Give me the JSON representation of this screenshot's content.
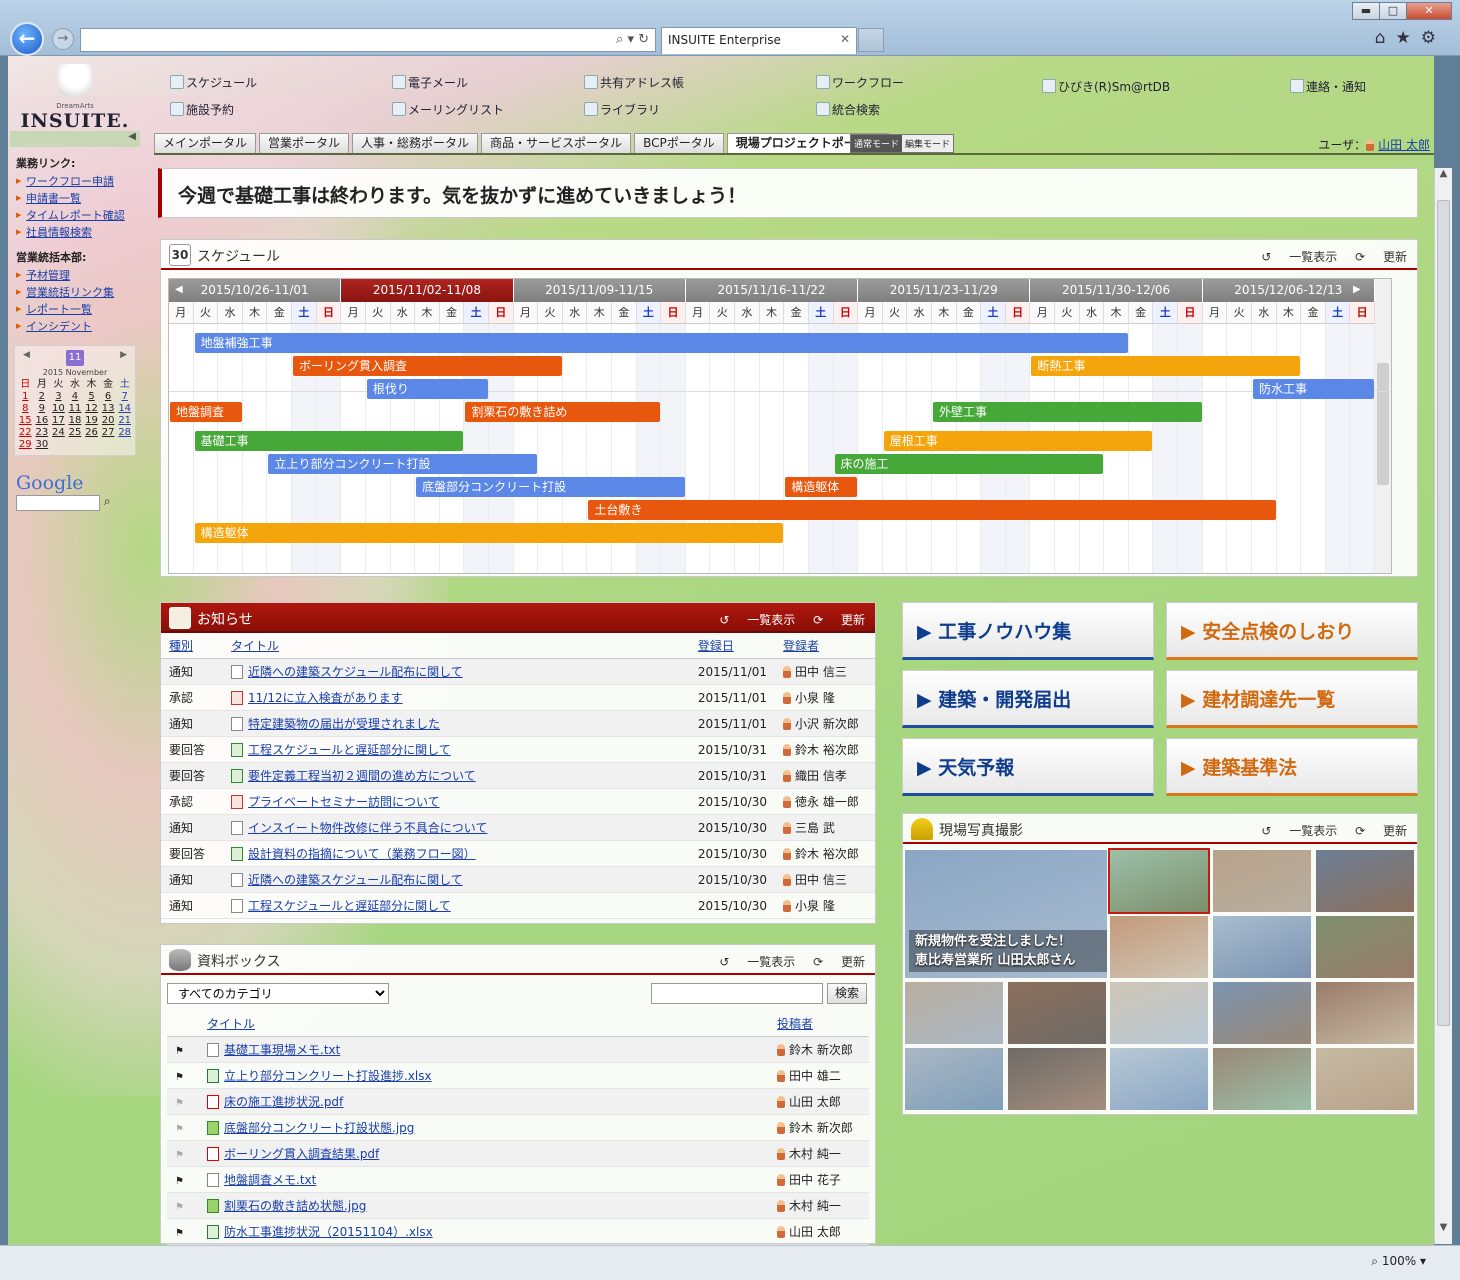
{
  "browser": {
    "tab_title": "INSUITE Enterprise",
    "zoom": "100%",
    "min_label": "▬",
    "max_label": "□",
    "close_label": "✕"
  },
  "header": {
    "logo_name": "INSUITE.",
    "logo_sub": "DreamArts",
    "menu": [
      {
        "label": "スケジュール",
        "icon": "calendar-icon"
      },
      {
        "label": "施設予約",
        "icon": "pen-icon"
      },
      {
        "label": "電子メール",
        "icon": "mail-icon"
      },
      {
        "label": "メーリングリスト",
        "icon": "mailing-list-icon"
      },
      {
        "label": "共有アドレス帳",
        "icon": "address-book-icon"
      },
      {
        "label": "ライブラリ",
        "icon": "library-icon"
      },
      {
        "label": "ワークフロー",
        "icon": "workflow-icon"
      },
      {
        "label": "統合検索",
        "icon": "search-icon"
      },
      {
        "label": "ひびき(R)Sm@rtDB",
        "icon": "database-icon"
      },
      {
        "label": "連絡・通知",
        "icon": "notice-icon"
      }
    ],
    "portal_tabs": [
      "メインポータル",
      "営業ポータル",
      "人事・総務ポータル",
      "商品・サービスポータル",
      "BCPポータル",
      "現場プロジェクトポータル"
    ],
    "active_tab": "現場プロジェクトポータル",
    "mode_normal": "通常モード",
    "mode_edit": "編集モード",
    "user_prefix": "ユーザ：",
    "user_name": "山田 太郎"
  },
  "sidebar": {
    "groups": [
      {
        "title": "業務リンク:",
        "items": [
          "ワークフロー申請",
          "申請書一覧",
          "タイムレポート確認",
          "社員情報検索"
        ]
      },
      {
        "title": "営業統括本部:",
        "items": [
          "予材管理",
          "営業統括リンク集",
          "レポート一覧",
          "インシデント"
        ]
      }
    ],
    "calendar": {
      "month_badge": "11",
      "year_month": "2015 November",
      "weekdays": [
        "日",
        "月",
        "火",
        "水",
        "木",
        "金",
        "土"
      ],
      "weeks": [
        [
          "1",
          "2",
          "3",
          "4",
          "5",
          "6",
          "7"
        ],
        [
          "8",
          "9",
          "10",
          "11",
          "12",
          "13",
          "14"
        ],
        [
          "15",
          "16",
          "17",
          "18",
          "19",
          "20",
          "21"
        ],
        [
          "22",
          "23",
          "24",
          "25",
          "26",
          "27",
          "28"
        ],
        [
          "29",
          "30",
          "",
          "",
          "",
          "",
          ""
        ]
      ]
    },
    "google_label": "Google"
  },
  "message": "今週で基礎工事は終わります。気を抜かずに進めていきましょう！",
  "schedule": {
    "title": "スケジュール",
    "calendar_num": "30",
    "list_label": "一覧表示",
    "refresh_label": "更新",
    "weeks": [
      "2015/10/26-11/01",
      "2015/11/02-11/08",
      "2015/11/09-11/15",
      "2015/11/16-11/22",
      "2015/11/23-11/29",
      "2015/11/30-12/06",
      "2015/12/06-12/13"
    ],
    "current_week": 1,
    "day_labels": [
      "月",
      "火",
      "水",
      "木",
      "金",
      "土",
      "日"
    ],
    "tasks": [
      {
        "name": "地盤補強工事",
        "start": 1,
        "days": 38,
        "row": 0,
        "color": "#5b87e6"
      },
      {
        "name": "ボーリング貫入調査",
        "start": 5,
        "days": 11,
        "row": 1,
        "color": "#e8570e"
      },
      {
        "name": "断熱工事",
        "start": 35,
        "days": 11,
        "row": 1,
        "color": "#f5a50c"
      },
      {
        "name": "根伐り",
        "start": 8,
        "days": 5,
        "row": 2,
        "color": "#5b87e6"
      },
      {
        "name": "防水工事",
        "start": 44,
        "days": 5,
        "row": 2,
        "color": "#5b87e6"
      },
      {
        "name": "地盤調査",
        "start": 0,
        "days": 3,
        "row": 3,
        "color": "#e8570e"
      },
      {
        "name": "割栗石の敷き詰め",
        "start": 12,
        "days": 8,
        "row": 3,
        "color": "#e8570e"
      },
      {
        "name": "外壁工事",
        "start": 31,
        "days": 11,
        "row": 3,
        "color": "#45a838"
      },
      {
        "name": "基礎工事",
        "start": 1,
        "days": 11,
        "row": 4,
        "color": "#45a838"
      },
      {
        "name": "屋根工事",
        "start": 29,
        "days": 11,
        "row": 4,
        "color": "#f5a50c"
      },
      {
        "name": "立上り部分コンクリート打設",
        "start": 4,
        "days": 11,
        "row": 5,
        "color": "#5b87e6"
      },
      {
        "name": "床の施工",
        "start": 27,
        "days": 11,
        "row": 5,
        "color": "#45a838"
      },
      {
        "name": "底盤部分コンクリート打設",
        "start": 10,
        "days": 11,
        "row": 6,
        "color": "#5b87e6"
      },
      {
        "name": "構造躯体",
        "start": 25,
        "days": 3,
        "row": 6,
        "color": "#e8570e"
      },
      {
        "name": "土台敷き",
        "start": 17,
        "days": 28,
        "row": 7,
        "color": "#e8570e"
      },
      {
        "name": "構造躯体",
        "start": 1,
        "days": 24,
        "row": 8,
        "color": "#f5a50c"
      }
    ]
  },
  "news": {
    "title": "お知らせ",
    "list_label": "一覧表示",
    "refresh_label": "更新",
    "columns": [
      "種別",
      "タイトル",
      "登録日",
      "登録者"
    ],
    "rows": [
      {
        "type": "通知",
        "title": "近隣への建築スケジュール配布に関して",
        "date": "2015/11/01",
        "user": "田中 信三",
        "icon": "doc"
      },
      {
        "type": "承認",
        "title": "11/12に立入検査があります",
        "date": "2015/11/01",
        "user": "小泉 隆",
        "icon": "red"
      },
      {
        "type": "通知",
        "title": "特定建築物の届出が受理されました",
        "date": "2015/11/01",
        "user": "小沢 新次郎",
        "icon": "doc"
      },
      {
        "type": "要回答",
        "title": "工程スケジュールと遅延部分に関して",
        "date": "2015/10/31",
        "user": "鈴木 裕次郎",
        "icon": "grn"
      },
      {
        "type": "要回答",
        "title": "要件定義工程当初２週間の進め方について",
        "date": "2015/10/31",
        "user": "織田 信孝",
        "icon": "grn"
      },
      {
        "type": "承認",
        "title": "プライベートセミナー訪問について",
        "date": "2015/10/30",
        "user": "徳永 雄一郎",
        "icon": "red"
      },
      {
        "type": "通知",
        "title": "インスイート物件改修に伴う不具合について",
        "date": "2015/10/30",
        "user": "三島 武",
        "icon": "doc"
      },
      {
        "type": "要回答",
        "title": "設計資料の指摘について（業務フロー図）",
        "date": "2015/10/30",
        "user": "鈴木 裕次郎",
        "icon": "grn"
      },
      {
        "type": "通知",
        "title": "近隣への建築スケジュール配布に関して",
        "date": "2015/10/30",
        "user": "田中 信三",
        "icon": "doc"
      },
      {
        "type": "通知",
        "title": "工程スケジュールと遅延部分に関して",
        "date": "2015/10/30",
        "user": "小泉 隆",
        "icon": "doc"
      }
    ]
  },
  "docbox": {
    "title": "資料ボックス",
    "list_label": "一覧表示",
    "refresh_label": "更新",
    "category": "すべてのカテゴリ",
    "search_label": "検索",
    "columns": [
      "タイトル",
      "投稿者"
    ],
    "rows": [
      {
        "flag": true,
        "title": "基礎工事現場メモ.txt",
        "user": "鈴木 新次郎",
        "icon": "doc"
      },
      {
        "flag": true,
        "title": "立上り部分コンクリート打設進捗.xlsx",
        "user": "田中 雄二",
        "icon": "xls"
      },
      {
        "flag": false,
        "title": "床の施工進捗状況.pdf",
        "user": "山田 太郎",
        "icon": "pdf"
      },
      {
        "flag": false,
        "title": "底盤部分コンクリート打設状態.jpg",
        "user": "鈴木 新次郎",
        "icon": "jpg"
      },
      {
        "flag": false,
        "title": "ボーリング貫入調査結果.pdf",
        "user": "木村 純一",
        "icon": "pdf"
      },
      {
        "flag": true,
        "title": "地盤調査メモ.txt",
        "user": "田中 花子",
        "icon": "doc"
      },
      {
        "flag": false,
        "title": "割栗石の敷き詰め状態.jpg",
        "user": "木村 純一",
        "icon": "jpg"
      },
      {
        "flag": true,
        "title": "防水工事進捗状況（20151104）.xlsx",
        "user": "山田 太郎",
        "icon": "xls"
      }
    ]
  },
  "links": [
    {
      "label": "▶ 工事ノウハウ集",
      "color": "blue"
    },
    {
      "label": "▶ 安全点検のしおり",
      "color": "orange"
    },
    {
      "label": "▶ 建築・開発届出",
      "color": "blue"
    },
    {
      "label": "▶ 建材調達先一覧",
      "color": "orange"
    },
    {
      "label": "▶ 天気予報",
      "color": "blue"
    },
    {
      "label": "▶ 建築基準法",
      "color": "orange"
    }
  ],
  "photos": {
    "title": "現場写真撮影",
    "list_label": "一覧表示",
    "refresh_label": "更新",
    "caption_line1": "新規物件を受注しました！",
    "caption_line2": "恵比寿営業所 山田太郎さん"
  }
}
